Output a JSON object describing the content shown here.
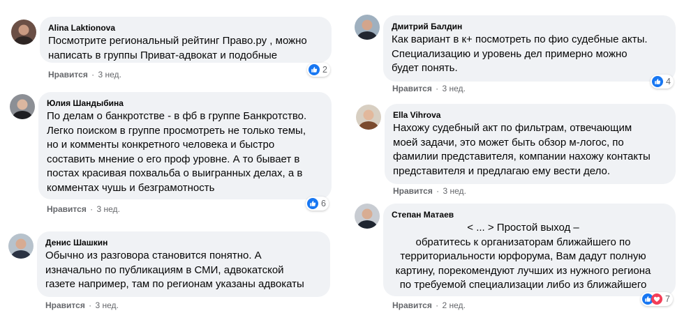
{
  "meta": {
    "like_label": "Нравится",
    "separator": "·"
  },
  "comments": [
    {
      "author": "Alina Laktionova",
      "text_before": "Посмотрите региональный рейтинг ",
      "link": "Право.ру",
      "text_after": " , можно\nнаписать в группы Приват-адвокат и подобные",
      "time": "3 нед.",
      "reactions": [
        "like-icon"
      ],
      "count": "2",
      "colors": {
        "avatar_bg": "#6b4f45",
        "face": "#c99a82",
        "shirt": "#2f2624"
      }
    },
    {
      "author": "Юлия Шандыбина",
      "text": "По делам о банкротстве -  в фб в группе Банкротство.\nЛегко поиском в группе просмотреть не только темы,\nно и комменты конкретного человека и быстро\nсоставить мнение о его проф уровне. А то бывает в\nпостах красивая похвальба о выигранных делах, а в\nкомментах чушь и безграмотность",
      "time": "3 нед.",
      "reactions": [
        "like-icon"
      ],
      "count": "6",
      "colors": {
        "avatar_bg": "#8c8f95",
        "face": "#dcb7a0",
        "shirt": "#1e1e22"
      }
    },
    {
      "author": "Денис Шашкин",
      "text": "Обычно из разговора становится понятно. А\nизначально по публикациям в СМИ, адвокатской\nгазете например, там по регионам указаны адвокаты",
      "time": "3 нед.",
      "reactions": [],
      "count": "",
      "colors": {
        "avatar_bg": "#b7c2cc",
        "face": "#d7ab92",
        "shirt": "#2a3242"
      }
    },
    {
      "author": "Дмитрий Балдин",
      "text": "Как вариант в к+ посмотреть по фио судебные акты.\nСпециализацию и уровень дел примерно можно\nбудет понять.",
      "time": "3 нед.",
      "reactions": [
        "like-icon"
      ],
      "count": "4",
      "colors": {
        "avatar_bg": "#9fb0bf",
        "face": "#d3a58c",
        "shirt": "#222630"
      }
    },
    {
      "author": "Ella Vihrova",
      "text": "Нахожу судебный акт по фильтрам, отвечающим\nмоей задачи, это может быть обзор м-логос, по\nфамилии представителя, компании нахожу контакты\nпредставителя и предлагаю ему вести дело.",
      "time": "3 нед.",
      "reactions": [],
      "count": "",
      "colors": {
        "avatar_bg": "#d8cfc2",
        "face": "#e2b89c",
        "shirt": "#7a4a2e"
      }
    },
    {
      "author": "Степан Матаев",
      "text": "< ... > Простой выход –\nобратитесь к организаторам ближайшего по\nтерриториальности юрфорума, Вам дадут полную\nкартину, порекомендуют лучших из нужного региона\nпо требуемой специализации либо из ближайшего",
      "time": "2 нед.",
      "reactions": [
        "like-icon",
        "heart-icon"
      ],
      "count": "7",
      "colors": {
        "avatar_bg": "#c8ccd2",
        "face": "#d8ad93",
        "shirt": "#1f2530"
      }
    }
  ],
  "colors": {
    "bubble": "#f0f2f5",
    "meta": "#65676b",
    "like_blue": "#1877f2",
    "heart_red": "#f33e58"
  }
}
